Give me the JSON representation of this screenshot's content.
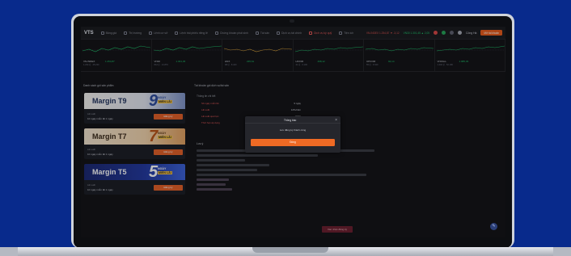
{
  "app": {
    "logo": "VTS",
    "menu": [
      {
        "label": "Bảng giá",
        "icon": "table-icon"
      },
      {
        "label": "Thị trường",
        "icon": "chart-icon"
      },
      {
        "label": "Lệnh cơ sở",
        "icon": "order-icon"
      },
      {
        "label": "Lệnh trái phiếu riêng lẻ",
        "icon": "bond-icon"
      },
      {
        "label": "Chứng khoán phái sinh",
        "icon": "derivative-icon"
      },
      {
        "label": "Tài sản",
        "icon": "asset-icon"
      },
      {
        "label": "Dịch vụ tài chính",
        "icon": "finance-icon"
      },
      {
        "label": "Dịch vụ ký quỹ",
        "icon": "margin-icon",
        "active": true
      },
      {
        "label": "Tiện ích",
        "icon": "utility-icon"
      }
    ],
    "tickers": [
      {
        "text": "VN-INDEX 1.254,87 ▼ -3,12",
        "up": false
      },
      {
        "text": "VN30 1.301,45 ▲ 2,05",
        "up": true
      }
    ],
    "user_name": "Công Hà",
    "open_account_label": "Mở tài khoản",
    "accent": "#e85d1e"
  },
  "market_indices": [
    {
      "name": "VN-INDEX",
      "value": "1.254,87",
      "sub": "1.234 tỷ · 45.230"
    },
    {
      "name": "VN30",
      "value": "1.301,45",
      "sub": "812 tỷ · 21.870"
    },
    {
      "name": "HNX",
      "value": "235,61",
      "sub": "98 tỷ · 8.420"
    },
    {
      "name": "HNX30",
      "value": "498,12",
      "sub": "41 tỷ · 3.100"
    },
    {
      "name": "UPCOM",
      "value": "92,14",
      "sub": "55 tỷ · 6.540"
    },
    {
      "name": "VNXALL",
      "value": "1.985,33",
      "sub": "1.402 tỷ · 52.180"
    }
  ],
  "left_panel": {
    "title": "Danh sách gói sản phẩm",
    "packages": [
      {
        "title": "Margin T9",
        "number": "9",
        "tag_top": "NGÀY",
        "tag_bottom": "MIỄN LÃI",
        "info1": "Lãi suất",
        "info2": "10 ngày miễn lãi 1 ngày",
        "button": "Đăng ký",
        "key": "t9"
      },
      {
        "title": "Margin T7",
        "number": "7",
        "tag_top": "NGÀY",
        "tag_bottom": "MIỄN LÃI",
        "info1": "Lãi suất",
        "info2": "10 ngày miễn lãi 1 ngày",
        "button": "Đăng ký",
        "key": "t7"
      },
      {
        "title": "Margin T5",
        "number": "5",
        "tag_top": "NGÀY",
        "tag_bottom": "MIỄN LÃI",
        "info1": "Lãi suất",
        "info2": "10 ngày miễn lãi 1 ngày",
        "button": "Đăng ký",
        "key": "t5"
      }
    ]
  },
  "right_panel": {
    "title": "Tài khoản gói dịch vụ/tài sản",
    "subtitle": "Thông tin chi tiết",
    "info_rows": [
      {
        "key": "Số ngày miễn lãi",
        "value": "9 ngày"
      },
      {
        "key": "Lãi suất",
        "value": "12%/năm"
      },
      {
        "key": "Lãi suất quá hạn",
        "value": "150%"
      },
      {
        "key": "Thời hạn áp dụng",
        "value": "30 ngày"
      }
    ],
    "note_title": "Lưu ý",
    "submit_label": "Xác nhận đăng ký"
  },
  "modal": {
    "title": "Thông báo",
    "message": "Lưu đăng ký thành công",
    "ok_label": "Đóng"
  },
  "chat_icon": "chat-icon"
}
